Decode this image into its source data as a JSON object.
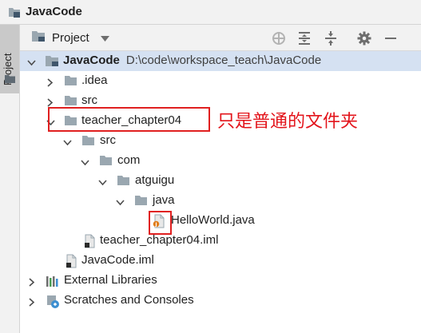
{
  "window": {
    "title": "JavaCode",
    "project_icon": "project-folder-icon"
  },
  "side_strip": {
    "tab_label": "Project",
    "tab_icon": "folder-icon"
  },
  "toolbar": {
    "view_label": "Project",
    "view_dropdown_icon": "chevron-down-icon",
    "buttons": [
      "locate-icon",
      "expand-all-icon",
      "collapse-all-icon",
      "gear-icon",
      "minimize-icon"
    ]
  },
  "tree": {
    "root": {
      "name": "JavaCode",
      "path": "D:\\code\\workspace_teach\\JavaCode"
    },
    "idea": ".idea",
    "src": "src",
    "teacher_chapter04": "teacher_chapter04",
    "ch_src": "src",
    "com": "com",
    "atguigu": "atguigu",
    "java": "java",
    "helloworld": "HelloWorld.java",
    "teacher_iml": "teacher_chapter04.iml",
    "javacode_iml": "JavaCode.iml",
    "external_libraries": "External Libraries",
    "scratches": "Scratches and Consoles"
  },
  "annotation": {
    "text": "只是普通的文件夹",
    "color": "#e3141b"
  }
}
